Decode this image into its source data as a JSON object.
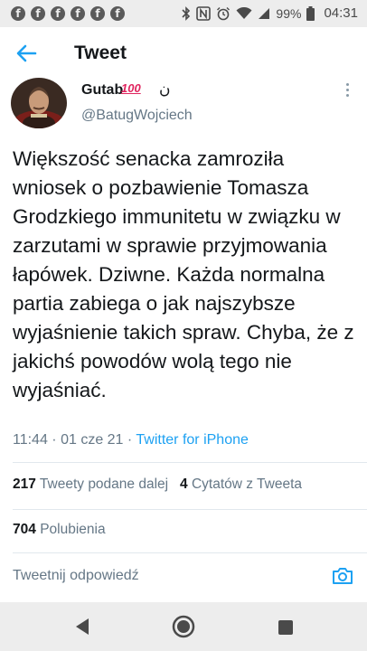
{
  "status_bar": {
    "notification_icons": [
      "f",
      "f",
      "f",
      "f",
      "f",
      "f"
    ],
    "battery": "99%",
    "time": "04:31"
  },
  "header": {
    "title": "Tweet"
  },
  "tweet": {
    "display_name": "Gutab",
    "name_emoji": "100",
    "name_extra": "ن",
    "username": "@BatugWojciech",
    "text": "Większość senacka zamroziła wniosek o pozbawienie Tomasza Grodzkiego immunitetu w związku w zarzutami w sprawie przyjmowania łapówek. Dziwne. Każda normalna partia zabiega o jak najszybsze wyjaśnienie takich spraw. Chyba, że z jakichś powodów wolą tego nie wyjaśniać.",
    "timestamp": "11:44 · 01 cze 21 · ",
    "source": "Twitter for iPhone"
  },
  "stats": {
    "retweets_count": "217",
    "retweets_label": "Tweety podane dalej",
    "quotes_count": "4",
    "quotes_label": "Cytatów z Tweeta",
    "likes_count": "704",
    "likes_label": "Polubienia"
  },
  "reply": {
    "placeholder": "Tweetnij odpowiedź"
  },
  "colors": {
    "accent": "#1da1f2",
    "secondary_text": "#657786",
    "primary_text": "#14171a",
    "system_bar": "#ededed"
  }
}
